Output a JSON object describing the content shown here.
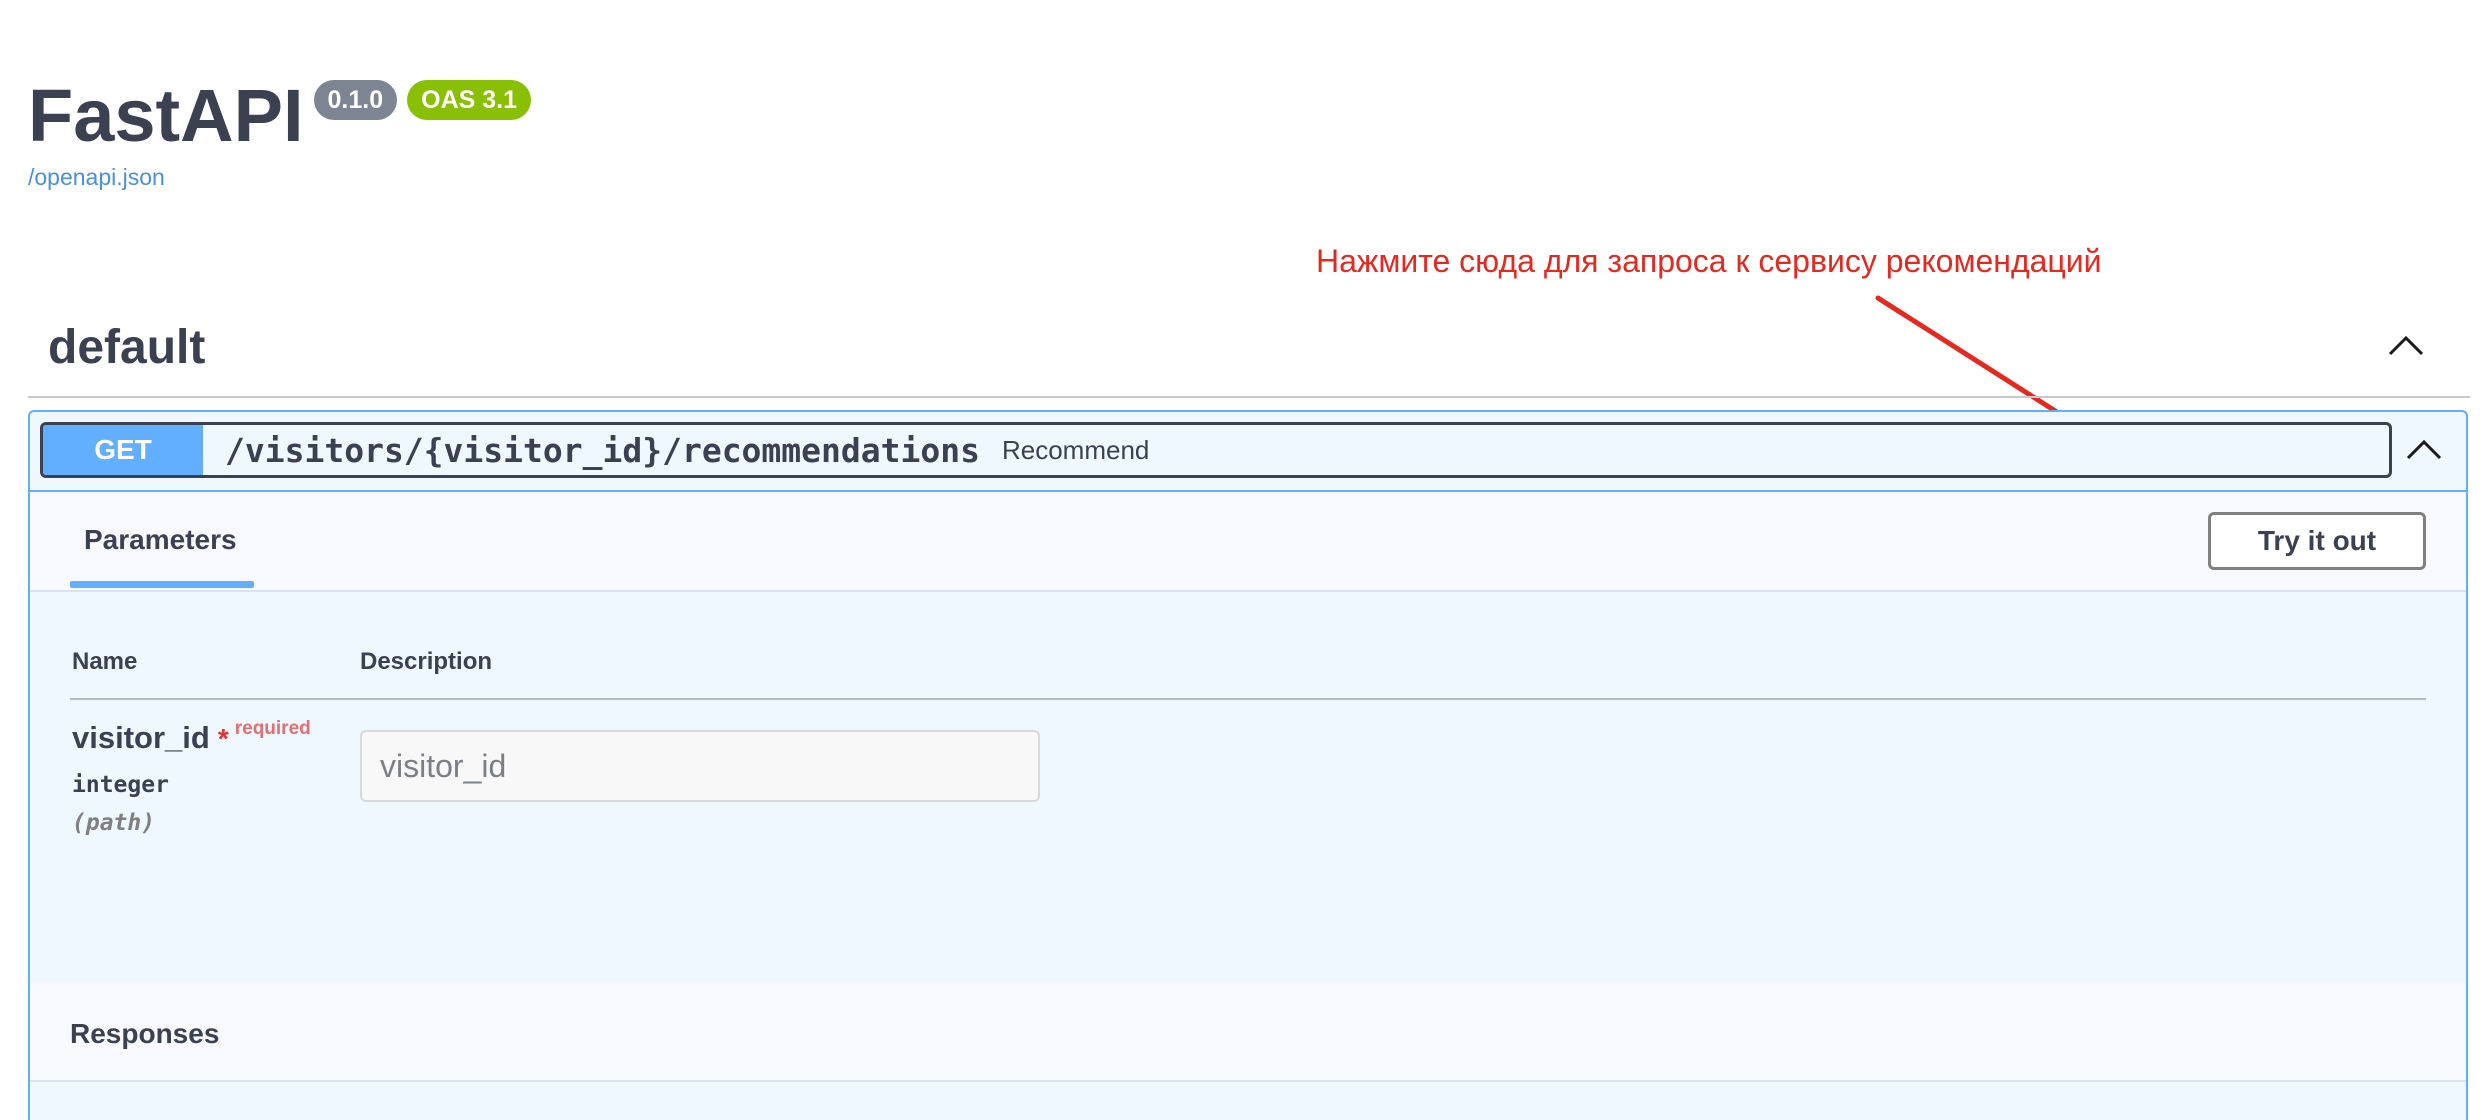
{
  "info": {
    "title": "FastAPI",
    "version_badge": "0.1.0",
    "oas_badge": "OAS 3.1",
    "spec_link": "/openapi.json"
  },
  "annotation": {
    "text": "Нажмите сюда для запроса к сервису рекомендаций",
    "color": "#e5291f"
  },
  "section": {
    "title": "default",
    "toggle_icon": "chevron-up-icon"
  },
  "operation": {
    "method": "GET",
    "path": "/visitors/{visitor_id}/recommendations",
    "summary": "Recommend",
    "method_color": "#61affe",
    "toggle_icon": "chevron-up-icon"
  },
  "parameters_panel": {
    "tab_label": "Parameters",
    "try_button_label": "Try it out",
    "columns": {
      "name": "Name",
      "description": "Description"
    },
    "params": [
      {
        "name": "visitor_id",
        "required_marker": "*",
        "required_label": "required",
        "type": "integer",
        "location": "(path)",
        "placeholder": "visitor_id",
        "value": ""
      }
    ]
  },
  "responses": {
    "label": "Responses"
  }
}
